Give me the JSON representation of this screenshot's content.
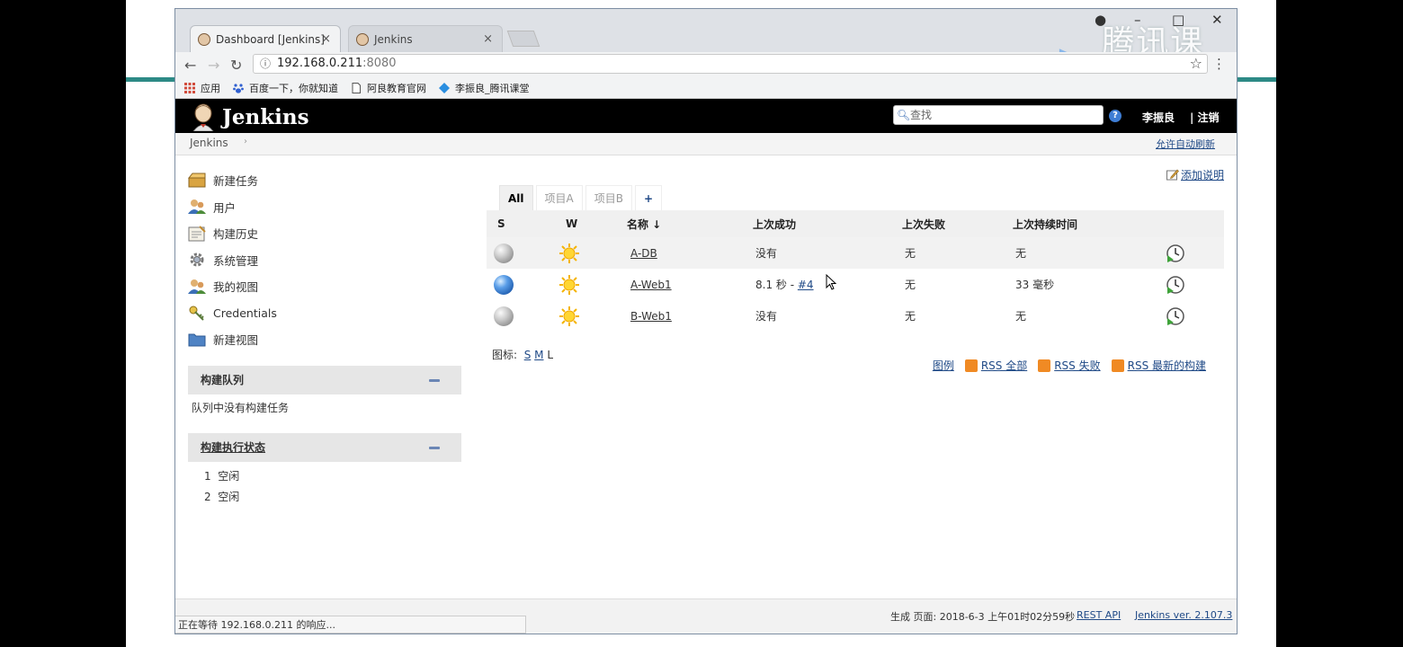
{
  "browser": {
    "tabs": [
      {
        "title": "Dashboard [Jenkins]",
        "close": "×"
      },
      {
        "title": "Jenkins",
        "close": "×"
      }
    ],
    "url_host": "192.168.0.211",
    "url_port": ":8080",
    "info_glyph": "ⓘ",
    "bookmarks": [
      "应用",
      "百度一下，你就知道",
      "阿良教育官网",
      "李振良_腾讯课堂"
    ],
    "watermark": "腾讯课堂",
    "status_text": "正在等待 192.168.0.211 的响应..."
  },
  "jenkins": {
    "title": "Jenkins",
    "search_placeholder": "查找",
    "help": "?",
    "user": "李振良",
    "logout": "| 注销",
    "breadcrumb": "Jenkins",
    "breadcrumb_arrow": "›",
    "auto_refresh": "允许自动刷新",
    "add_description": "添加说明",
    "sidebar": [
      {
        "label": "新建任务",
        "icon": "new-item-icon"
      },
      {
        "label": "用户",
        "icon": "people-icon"
      },
      {
        "label": "构建历史",
        "icon": "build-history-icon"
      },
      {
        "label": "系统管理",
        "icon": "gear-icon"
      },
      {
        "label": "我的视图",
        "icon": "my-views-icon"
      },
      {
        "label": "Credentials",
        "icon": "credentials-icon"
      },
      {
        "label": "新建视图",
        "icon": "folder-icon"
      }
    ],
    "build_queue": {
      "title": "构建队列",
      "empty": "队列中没有构建任务"
    },
    "executor_status": {
      "title": "构建执行状态",
      "executors": [
        {
          "num": "1",
          "state": "空闲"
        },
        {
          "num": "2",
          "state": "空闲"
        }
      ]
    },
    "view_tabs": [
      "All",
      "项目A",
      "项目B",
      "+"
    ],
    "columns": {
      "s": "S",
      "w": "W",
      "name": "名称 ↓",
      "last_success": "上次成功",
      "last_failure": "上次失败",
      "last_duration": "上次持续时间"
    },
    "jobs": [
      {
        "status": "grey",
        "weather": "sunny",
        "name": "A-DB",
        "last_success": "没有",
        "build_link": "",
        "last_failure": "无",
        "last_duration": "无"
      },
      {
        "status": "blue",
        "weather": "sunny",
        "name": "A-Web1",
        "last_success": "8.1 秒 - ",
        "build_link": "#4",
        "last_failure": "无",
        "last_duration": "33 毫秒"
      },
      {
        "status": "grey",
        "weather": "sunny",
        "name": "B-Web1",
        "last_success": "没有",
        "build_link": "",
        "last_failure": "无",
        "last_duration": "无"
      }
    ],
    "icon_size": {
      "label": "图标:",
      "s": "S",
      "m": "M",
      "l": "L"
    },
    "feeds": {
      "legend": "图例",
      "all": "RSS 全部",
      "failed": "RSS 失败",
      "latest": "RSS 最新的构建"
    },
    "footer": {
      "generated": "生成 页面: 2018-6-3 上午01时02分59秒",
      "rest_api": "REST API",
      "version": "Jenkins ver. 2.107.3"
    }
  },
  "colors": {
    "jenkins_header": "#000000",
    "link": "#204a87",
    "slide_bar": "#2d8a86"
  }
}
